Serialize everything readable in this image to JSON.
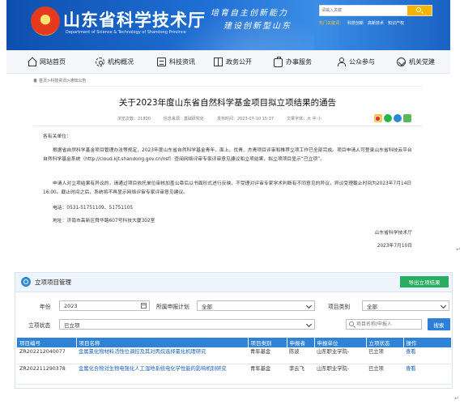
{
  "site": {
    "title": "山东省科学技术厅",
    "subtitle": "Department of Science & Technology of Shandong Province",
    "slogan_line1": "培育自主创新能力",
    "slogan_line2": "建设创新型山东",
    "search_placeholder": "请输入关键",
    "hot_label": "热门关键词：",
    "hot_keywords": [
      "科技创新",
      "高新技术",
      "知识产权"
    ],
    "nav": [
      "网站首页",
      "机构概况",
      "科技资讯",
      "政务公开",
      "办事服务",
      "公众参与",
      "机关党建"
    ],
    "breadcrumb": "首页>科技资讯>通知公告"
  },
  "article": {
    "title": "关于2023年度山东省自然科学基金项目拟立项结果的通告",
    "views": "浏览次数：21800",
    "source": "信息来源：基础研究处",
    "date": "发布时间：2023-07-10 15:37",
    "font_size": "文章字体：大 中 小",
    "greeting": "各有关单位：",
    "para1": "根据省自然科学基金项目管理办法等规定，2023年度山东省自然科学基金青年、面上、优青、杰青项目评审和推荐立项工作已全部完成。项目申请人可登录山东省科技云平台自然科学基金系统（http://cloud.kjt.shandong.gov.cn/nsf）查阅网络评审专家评审意见建议和立项结果，拟立项项目显示“已立项”。",
    "para2": "申请人对立项结果有异议的，请通过项目依托单位审核加盖公章后以书面形式进行反映，不受理对评审专家学术判断有不同意见的异议，异议受理截止时间为2023年7月14日16:00。截止时间之后，系统将不再显示网络评审专家评审意见建议。",
    "tel": "电话：0531-51751109、51751105",
    "address": "地址：济南市高新区舜华路607号科技大厦302室",
    "signer": "山东省科学技术厅",
    "sign_date": "2023年7月10日"
  },
  "panel": {
    "title": "立项项目管理",
    "export_label": "导出立项结果",
    "filters": {
      "year_label": "年份",
      "year_value": "2023",
      "plan_label": "所属申报计划",
      "plan_value": "全部",
      "category_label": "项目类别",
      "category_value": "全部",
      "status_label": "立项状态",
      "status_value": "已立项",
      "search_placeholder": "项目名称/申报人",
      "search_button": "搜索"
    },
    "table": {
      "headers": [
        "项目编号",
        "项目名称",
        "项目类别",
        "申报者",
        "申报单位",
        "立项状态",
        "操作"
      ],
      "rows": [
        {
          "id": "ZR202212040077",
          "name": "金属氯化物材料活性位调控及其对丙烷选择氯化机理研究",
          "category": "青年基金",
          "applicant": "陈波",
          "unit": "山东职业学院-",
          "status": "已立项",
          "action": "查看"
        },
        {
          "id": "ZR202211290378",
          "name": "金属化合物对生物电强化人工湿地系统电化学性能的影响机制研究",
          "category": "青年基金",
          "applicant": "李云飞",
          "unit": "山东职业学院-",
          "status": "已立项",
          "action": "查看"
        }
      ]
    }
  }
}
